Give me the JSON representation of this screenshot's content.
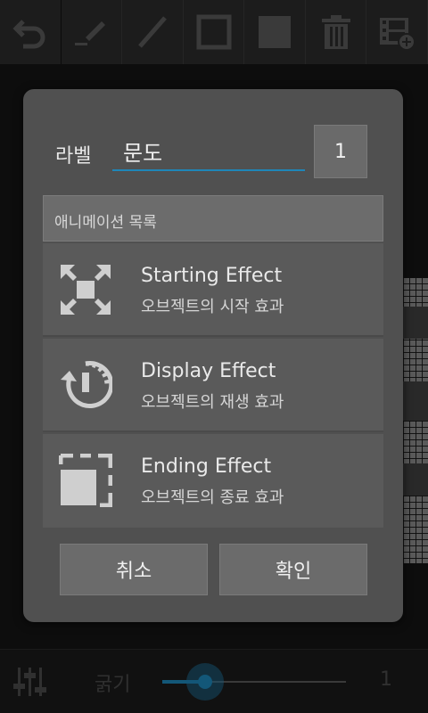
{
  "toolbar": {
    "tools": [
      "undo-icon",
      "pencil-icon",
      "line-icon",
      "rectangle-icon",
      "fill-rect-icon",
      "trash-icon",
      "film-add-icon"
    ]
  },
  "dialog": {
    "label_text": "라벨",
    "name_value": "문도",
    "id_value": "1",
    "list_header": "애니메이션 목록",
    "items": [
      {
        "title": "Starting Effect",
        "subtitle": "오브젝트의 시작 효과",
        "icon": "expand-arrows-icon"
      },
      {
        "title": "Display Effect",
        "subtitle": "오브젝트의 재생 효과",
        "icon": "power-cycle-icon"
      },
      {
        "title": "Ending Effect",
        "subtitle": "오브젝트의 종료 효과",
        "icon": "dashed-square-icon"
      }
    ],
    "cancel_label": "취소",
    "ok_label": "확인"
  },
  "bottombar": {
    "thickness_label": "굵기",
    "thickness_value": "1",
    "slider_fraction": 0.1
  },
  "colors": {
    "accent": "#1e86b8",
    "dialog_bg": "#505050",
    "item_bg": "#5a5a5a"
  }
}
